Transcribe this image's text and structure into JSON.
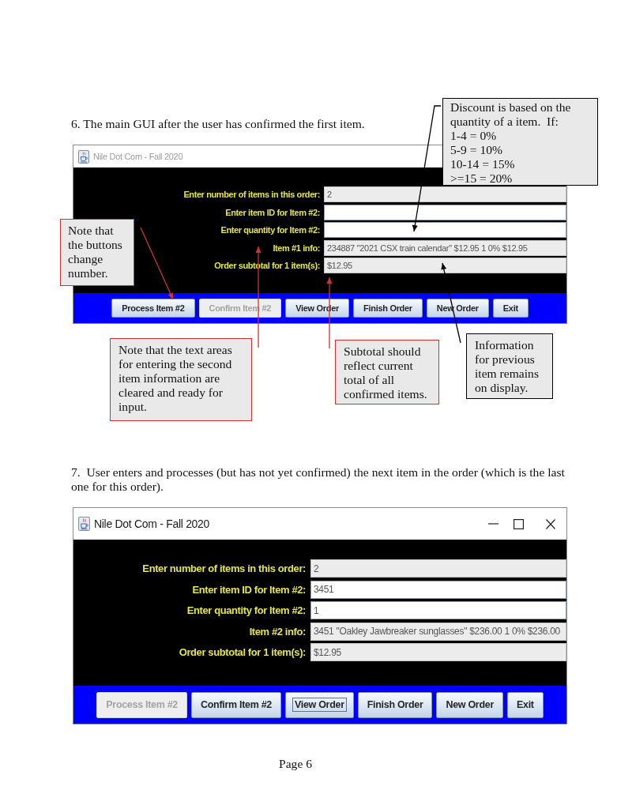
{
  "sections": [
    {
      "caption": "6. The main GUI after the user has confirmed the first item.",
      "window": {
        "title": "Nile Dot Com - Fall 2020",
        "active": false,
        "title_buttons": false,
        "fields": [
          {
            "label": "Enter number of items in this order:",
            "value": "2",
            "editable": false
          },
          {
            "label": "Enter item ID for Item #2:",
            "editable": true
          },
          {
            "label": "Enter quantity for Item #2:",
            "editable": true
          },
          {
            "label": "Item #1 info:",
            "value": "234887 \"2021 CSX train calendar\" $12.95 1 0% $12.95",
            "editable": false
          },
          {
            "label": "Order subtotal for 1 item(s):",
            "value": "$12.95",
            "editable": false
          }
        ],
        "buttons": [
          {
            "label": "Process Item #2",
            "disabled": false,
            "focused": false
          },
          {
            "label": "Confirm Item #2",
            "disabled": true,
            "focused": false
          },
          {
            "label": "View Order",
            "disabled": false,
            "focused": false
          },
          {
            "label": "Finish Order",
            "disabled": false,
            "focused": false
          },
          {
            "label": "New Order",
            "disabled": false,
            "focused": false
          },
          {
            "label": "Exit",
            "disabled": false,
            "focused": false
          }
        ]
      },
      "callouts": [
        {
          "text": "Discount is based on the quantity of a item.  If:\n1-4 = 0%\n5-9 = 10%\n10-14 = 15%\n>=15 = 20%",
          "color": "#000000"
        },
        {
          "text": "Note that the buttons change number.",
          "color": "#cc3333"
        },
        {
          "text": "Note that the text areas for entering the second item information are cleared and ready for input.",
          "color": "#cc3333"
        },
        {
          "text": "Subtotal should reflect current total of all confirmed items.",
          "color": "#cc3333"
        },
        {
          "text": "Information for previous item remains on display.",
          "color": "#000000"
        }
      ]
    },
    {
      "caption": "7.  User enters and processes (but has not yet confirmed) the next item in the order (which is the last one for this order).",
      "window": {
        "title": "Nile Dot Com - Fall 2020",
        "active": true,
        "title_buttons": true,
        "fields": [
          {
            "label": "Enter number of items in this order:",
            "value": "2",
            "editable": false
          },
          {
            "label": "Enter item ID for Item #2:",
            "value": "3451",
            "editable": true
          },
          {
            "label": "Enter quantity for Item #2:",
            "value": "1",
            "editable": true
          },
          {
            "label": "Item #2 info:",
            "value": "3451 \"Oakley Jawbreaker sunglasses\" $236.00 1 0% $236.00",
            "editable": false
          },
          {
            "label": "Order subtotal for 1 item(s):",
            "value": "$12.95",
            "editable": false
          }
        ],
        "buttons": [
          {
            "label": "Process Item #2",
            "disabled": true,
            "focused": false
          },
          {
            "label": "Confirm Item #2",
            "disabled": false,
            "focused": false
          },
          {
            "label": "View Order",
            "disabled": false,
            "focused": true
          },
          {
            "label": "Finish Order",
            "disabled": false,
            "focused": false
          },
          {
            "label": "New Order",
            "disabled": false,
            "focused": false
          },
          {
            "label": "Exit",
            "disabled": false,
            "focused": false
          }
        ]
      }
    }
  ],
  "page_number": "Page 6"
}
